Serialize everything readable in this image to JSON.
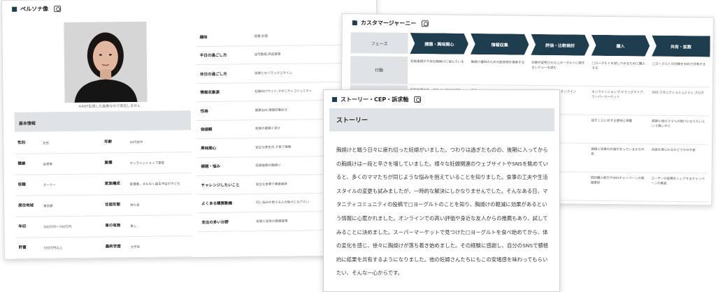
{
  "persona": {
    "title": "ペルソナ像",
    "photo_note": "※AIが生成した画像なので実在しません",
    "basic_header": "基本情報",
    "basic": [
      {
        "k1": "性別",
        "v1": "女性",
        "k2": "年齢",
        "v2": "30代前半"
      },
      {
        "k1": "職業",
        "v1": "自営業",
        "k2": "業種",
        "v2": "オンラインショップ運営"
      },
      {
        "k1": "役職",
        "v1": "オーナー",
        "k2": "家族構成",
        "v2": "配偶者、まもなく誕生予定の子ども"
      },
      {
        "k1": "居住地域",
        "v1": "東京都",
        "k2": "住居形態",
        "v2": "持ち家"
      },
      {
        "k1": "年収",
        "v1": "500万円〜700万円",
        "k2": "車の有無",
        "v2": "無し"
      },
      {
        "k1": "貯蓄",
        "v1": "500万円以上",
        "k2": "最終学歴",
        "v2": "大学卒"
      }
    ],
    "details": [
      {
        "k": "趣味",
        "v": "読書,料理"
      },
      {
        "k": "平日の過ごし方",
        "v": "自宅勤務,商品管理"
      },
      {
        "k": "休日の過ごし方",
        "v": "家族とのリラックスタイム"
      },
      {
        "k": "情報収集源",
        "v": "妊娠向けサイト,マタニティコミュニティ"
      },
      {
        "k": "性格",
        "v": "健康志向,情報収集好き"
      },
      {
        "k": "価値観",
        "v": "家族の健康と幸せ"
      },
      {
        "k": "興味関心",
        "v": "安全な食生活,子育て情報"
      },
      {
        "k": "課題・悩み",
        "v": "妊娠後期の胸焼け"
      },
      {
        "k": "チャレンジしたいこと",
        "v": "安全な食事で健康維持"
      },
      {
        "k": "よくある購買動機",
        "v": "同じ悩みを抱える人の助けになりたい"
      },
      {
        "k": "支出の多い分野",
        "v": "家族と自身の健康管理"
      }
    ]
  },
  "journey": {
    "title": "カスタマージャーニー",
    "phase_label": "フェーズ",
    "phases": [
      "課題・興味関心",
      "情報収集",
      "評価・比較検討",
      "購入",
      "共有・拡散"
    ],
    "row_label": "行動",
    "row1": [
      "妊娠後期の不快な胸焼けに悩んでいる",
      "胸焼け緩和のための飲食物を検索する",
      "効果が証明された□ヨーグルトに関するレビューを読む",
      "□ヨーグルトを試してみるために購入する",
      "□ヨーグルトの効果をSNSで共有する"
    ],
    "row2": [
      "妊娠後期のウェブサイトでSNS投稿",
      "妊婦コミュニティのチェック",
      "SNSレビューサイト,オンライン",
      "オンラインショップ,ドラッグストア,スーパーマーケット",
      "SNS,マタニティコミュニティ,ブログ"
    ],
    "row3": [
      "",
      "",
      "しい製品への期待",
      "試すことに対する期待と興奮",
      "感謝と他のママへの助けになりたいという思いやり"
    ],
    "row4": [
      "",
      "",
      "うかの確証が",
      "価格と効果の対価が合っているかの不安",
      "共感を得られるかどうかの不安"
    ],
    "row5": [
      "",
      "",
      "い製品のレビ",
      "初回購入割引やSNSキャンペーンの情報提供",
      "ユーザーの投稿をシェアするキャンペーンの推進"
    ]
  },
  "story": {
    "title": "ストーリー・CEP・訴求軸",
    "heading": "ストーリー",
    "body": "胸焼けと戦う日々に疲れ切った妊婦がいました。つわりは過ぎたものの、後期に入ってからの胸焼けは一段と辛さを増していました。様々な妊娠関連のウェブサイトやSNSを眺めていると、多くのママたちが同じような悩みを抱えていることを知りました。食事の工夫や生活スタイルの変更も試みましたが、一時的な解決にしかなりませんでした。そんなある日、マタニティコミュニティの投稿で□ヨーグルトのことを知り、胸焼けの軽減に効果があるという情報に心惹かれました。オンラインでの高い評価や身近な友人からの推薦もあり、試してみることに決めました。スーパーマーケットで見つけた□ヨーグルトを食べ始めてから、体の変化を感じ、徐々に胸焼けが落ち着き始めました。その経験に感謝し、自分のSNSで積極的に結果を共有するようになりました。他の妊婦さんたちにもこの安堵感を味わってもらいたい、そんな一心からです。"
  }
}
